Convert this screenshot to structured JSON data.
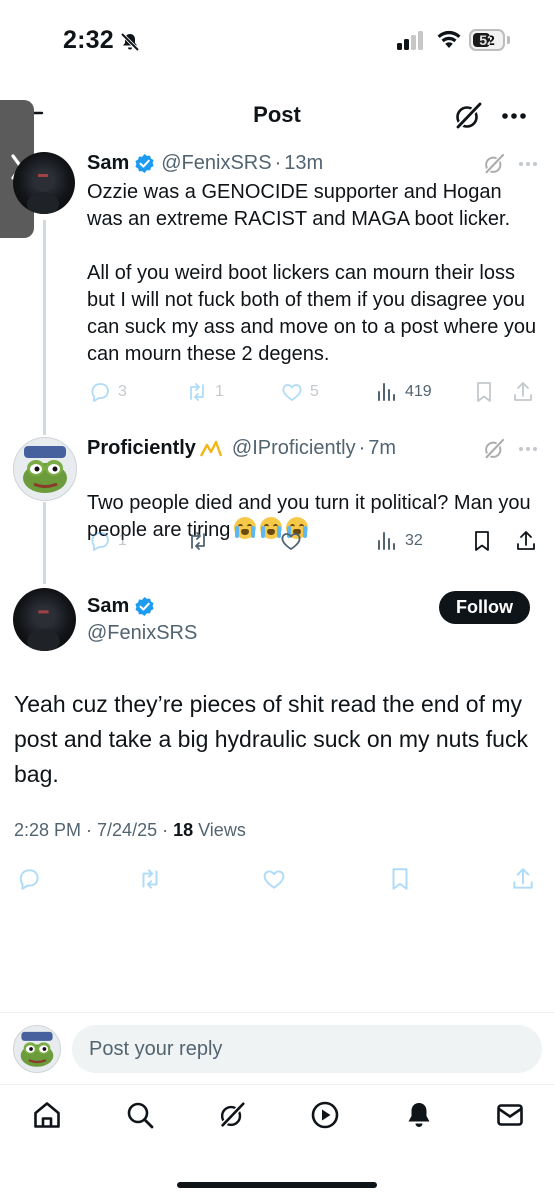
{
  "status_bar": {
    "time": "2:32",
    "battery": "52"
  },
  "header": {
    "title": "Post"
  },
  "replied_posts": [
    {
      "name": "Sam",
      "handle": "@FenixSRS",
      "time": "13m",
      "text": "Ozzie was a GENOCIDE supporter and Hogan was an extreme RACIST and MAGA boot licker.\n\nAll of you weird boot lickers can mourn their loss but I will not fuck both of them if you disagree you can suck my ass and move on to a post where you can mourn these 2 degens.",
      "replies": "3",
      "reposts": "1",
      "likes": "5",
      "views": "419"
    },
    {
      "name": "Proficiently",
      "handle": "@IProficiently",
      "time": "7m",
      "text": "Two people died and you turn it political? Man you people are tiring",
      "emoji": [
        "loudly-crying-face",
        "loudly-crying-face",
        "loudly-crying-face"
      ],
      "replies": "1",
      "views": "32"
    }
  ],
  "main_post": {
    "name": "Sam",
    "handle": "@FenixSRS",
    "follow_label": "Follow",
    "text": "Yeah cuz they’re pieces of shit read the end of my post and take a big hydraulic suck on my nuts fuck bag.",
    "timestamp": "2:28 PM · 7/24/25 · ",
    "views_count": "18",
    "views_label": " Views"
  },
  "reply_bar": {
    "placeholder": "Post your reply"
  },
  "bottom_nav": [
    "home-icon",
    "search-icon",
    "grok-icon",
    "video-icon",
    "notifications-icon",
    "messages-icon"
  ],
  "colors": {
    "text": "#0f1419",
    "secondary": "#536471",
    "verified": "#1d9bf0",
    "thread_line": "#cfd9de"
  }
}
